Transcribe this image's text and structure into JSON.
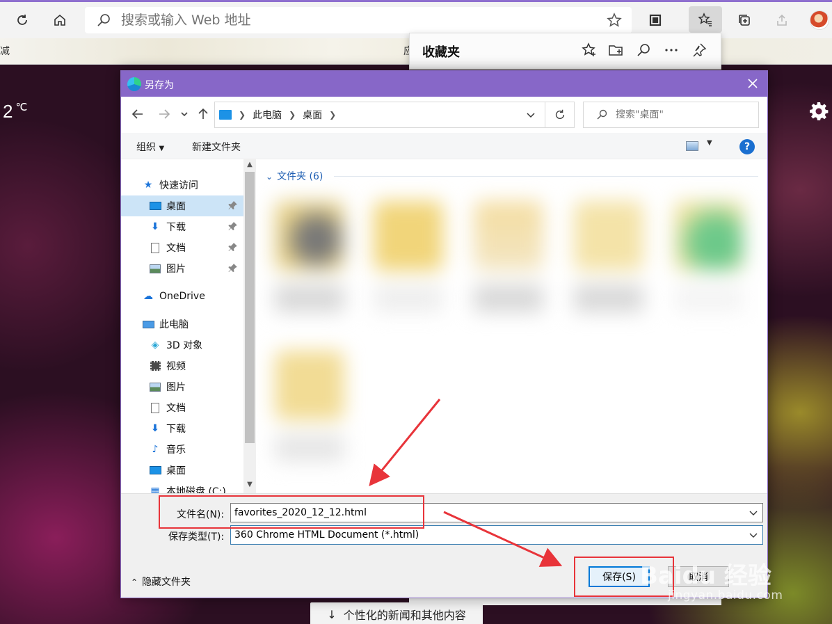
{
  "browser": {
    "address_placeholder": "搜索或输入 Web 地址",
    "bookmark_fragments": [
      "减",
      "应"
    ]
  },
  "favorites_panel": {
    "title": "收藏夹"
  },
  "background": {
    "temperature": "2",
    "temperature_unit": "℃",
    "news_button": "个性化的新闻和其他内容"
  },
  "dialog": {
    "title": "另存为",
    "breadcrumb": [
      "此电脑",
      "桌面"
    ],
    "search_placeholder": "搜索\"桌面\"",
    "toolbar": {
      "organize": "组织",
      "new_folder": "新建文件夹",
      "help": "?"
    },
    "sidebar": {
      "quick_access": "快速访问",
      "quick_items": [
        "桌面",
        "下载",
        "文档",
        "图片"
      ],
      "onedrive": "OneDrive",
      "this_pc": "此电脑",
      "pc_items": [
        "3D 对象",
        "视频",
        "图片",
        "文档",
        "下载",
        "音乐",
        "桌面",
        "本地磁盘 (C:)"
      ]
    },
    "content": {
      "group_header": "文件夹 (6)"
    },
    "form": {
      "filename_label": "文件名(N):",
      "filename_value": "favorites_2020_12_12.html",
      "filetype_label": "保存类型(T):",
      "filetype_value": "360 Chrome HTML Document (*.html)",
      "hide_folders": "隐藏文件夹",
      "save_button": "保存(S)",
      "cancel_button": "取消"
    }
  },
  "watermark": {
    "brand": "Baidu 经验",
    "url": "jingyan.baidu.com"
  },
  "colors": {
    "dialog_titlebar": "#8767c8",
    "annotation_red": "#e8343a",
    "link_blue": "#1f5fb3",
    "selection": "#cce4f7"
  }
}
